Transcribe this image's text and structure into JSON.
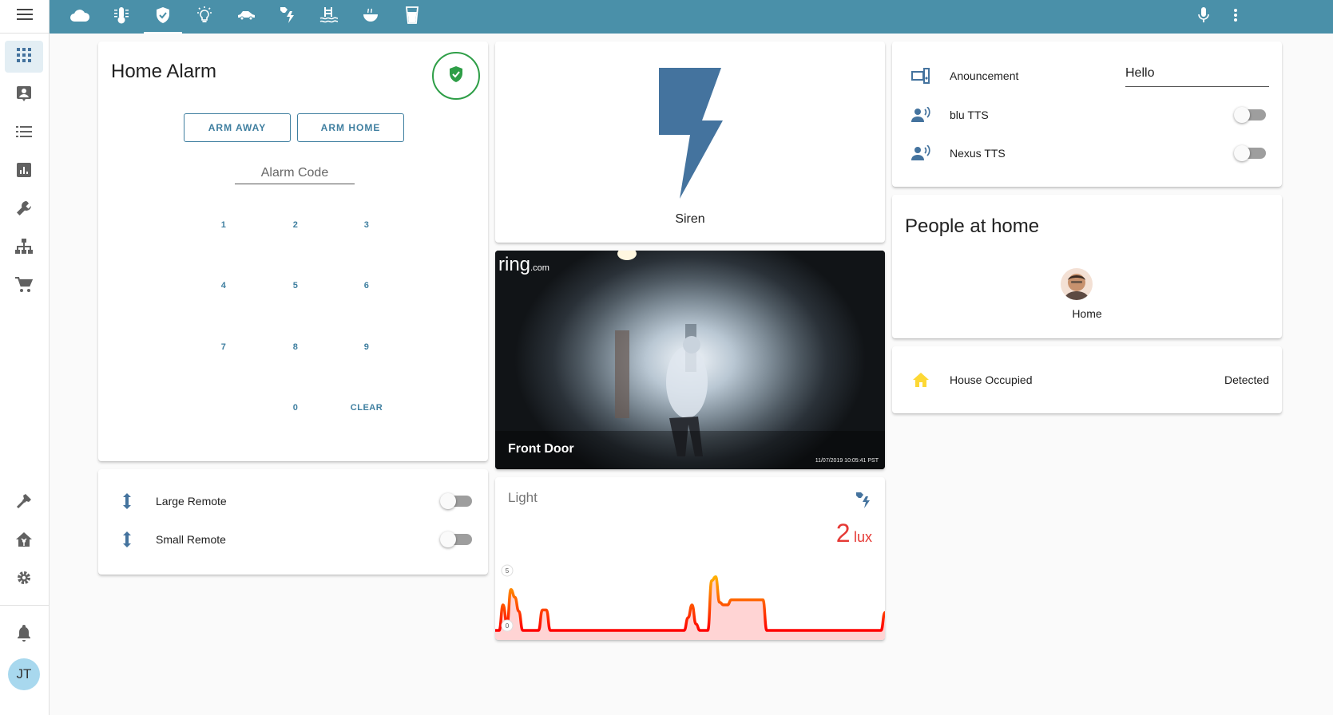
{
  "colors": {
    "accent": "#4a90a9",
    "icon_blue": "#44739e",
    "alarm_green": "#2e9e47",
    "lux_red": "#e53935",
    "home_yellow": "#fdd835"
  },
  "sidebar": {
    "menu_icon": "menu-icon",
    "items": [
      {
        "icon": "dashboard-grid-icon",
        "active": true
      },
      {
        "icon": "account-box-icon"
      },
      {
        "icon": "format-list-icon"
      },
      {
        "icon": "chart-box-icon"
      },
      {
        "icon": "wrench-icon"
      },
      {
        "icon": "sitemap-icon"
      },
      {
        "icon": "cart-icon"
      }
    ],
    "bottom_items": [
      {
        "icon": "hammer-icon"
      },
      {
        "icon": "home-assistant-icon"
      },
      {
        "icon": "cog-icon"
      }
    ],
    "notifications_icon": "bell-icon",
    "user_initials": "JT"
  },
  "topbar": {
    "tabs": [
      {
        "icon": "weather-cloudy-icon"
      },
      {
        "icon": "thermometer-icon"
      },
      {
        "icon": "shield-icon",
        "active": true
      },
      {
        "icon": "lightbulb-icon"
      },
      {
        "icon": "car-icon"
      },
      {
        "icon": "weather-lightning-icon"
      },
      {
        "icon": "pool-icon"
      },
      {
        "icon": "bowl-icon"
      },
      {
        "icon": "cup-icon"
      }
    ],
    "mic_icon": "microphone-icon",
    "overflow_icon": "dots-vertical-icon"
  },
  "alarm": {
    "title": "Home Alarm",
    "status_icon": "shield-check-icon",
    "arm_away": "ARM AWAY",
    "arm_home": "ARM HOME",
    "code_placeholder": "Alarm Code",
    "keys": [
      "1",
      "2",
      "3",
      "4",
      "5",
      "6",
      "7",
      "8",
      "9",
      "0",
      "CLEAR"
    ]
  },
  "remotes": {
    "rows": [
      {
        "label": "Large Remote",
        "icon": "swap-vertical-icon",
        "on": false
      },
      {
        "label": "Small Remote",
        "icon": "swap-vertical-icon",
        "on": false
      }
    ]
  },
  "siren": {
    "label": "Siren",
    "icon": "flash-icon"
  },
  "camera": {
    "logo": "ring",
    "logo_suffix": ".com",
    "title": "Front Door",
    "timestamp": "11/07/2019 10:05:41 PST"
  },
  "light": {
    "name": "Light",
    "value": "2",
    "unit": "lux",
    "icon": "weather-lightning-icon",
    "axis_max": "5",
    "axis_min": "0"
  },
  "chart_data": {
    "type": "area",
    "ylim": [
      0,
      5
    ],
    "series": [
      {
        "values": [
          0,
          0,
          2,
          0.5,
          3.2,
          2.6,
          1.5,
          0,
          0,
          0,
          0,
          0,
          1.6,
          1.6,
          0,
          0,
          0,
          0,
          0,
          0,
          0,
          0,
          0,
          0,
          0,
          0,
          0,
          0,
          0,
          0,
          0,
          0,
          0,
          0,
          0,
          0,
          0,
          0,
          0,
          0,
          0,
          0,
          0,
          0,
          0,
          0,
          0,
          0,
          0,
          1,
          2,
          0.5,
          0,
          0,
          0,
          3.9,
          4.2,
          2.2,
          2,
          2,
          2.4,
          2.4,
          2.4,
          2.4,
          2.4,
          2.4,
          2.4,
          2.4,
          2.4,
          0,
          0,
          0,
          0,
          0,
          0,
          0,
          0,
          0,
          0,
          0,
          0,
          0,
          0,
          0,
          0,
          0,
          0,
          0,
          0,
          0,
          0,
          0,
          0,
          0,
          0,
          0,
          0,
          0,
          0,
          1.4
        ]
      }
    ]
  },
  "tts": {
    "announcement_label": "Anouncement",
    "announcement_icon": "speaker-icon",
    "announcement_value": "Hello",
    "rows": [
      {
        "label": "blu TTS",
        "icon": "account-voice-icon",
        "on": false
      },
      {
        "label": "Nexus TTS",
        "icon": "account-voice-icon",
        "on": false
      }
    ]
  },
  "people": {
    "title": "People at home",
    "person_state": "Home"
  },
  "occupied": {
    "label": "House Occupied",
    "icon": "home-icon",
    "state": "Detected"
  }
}
